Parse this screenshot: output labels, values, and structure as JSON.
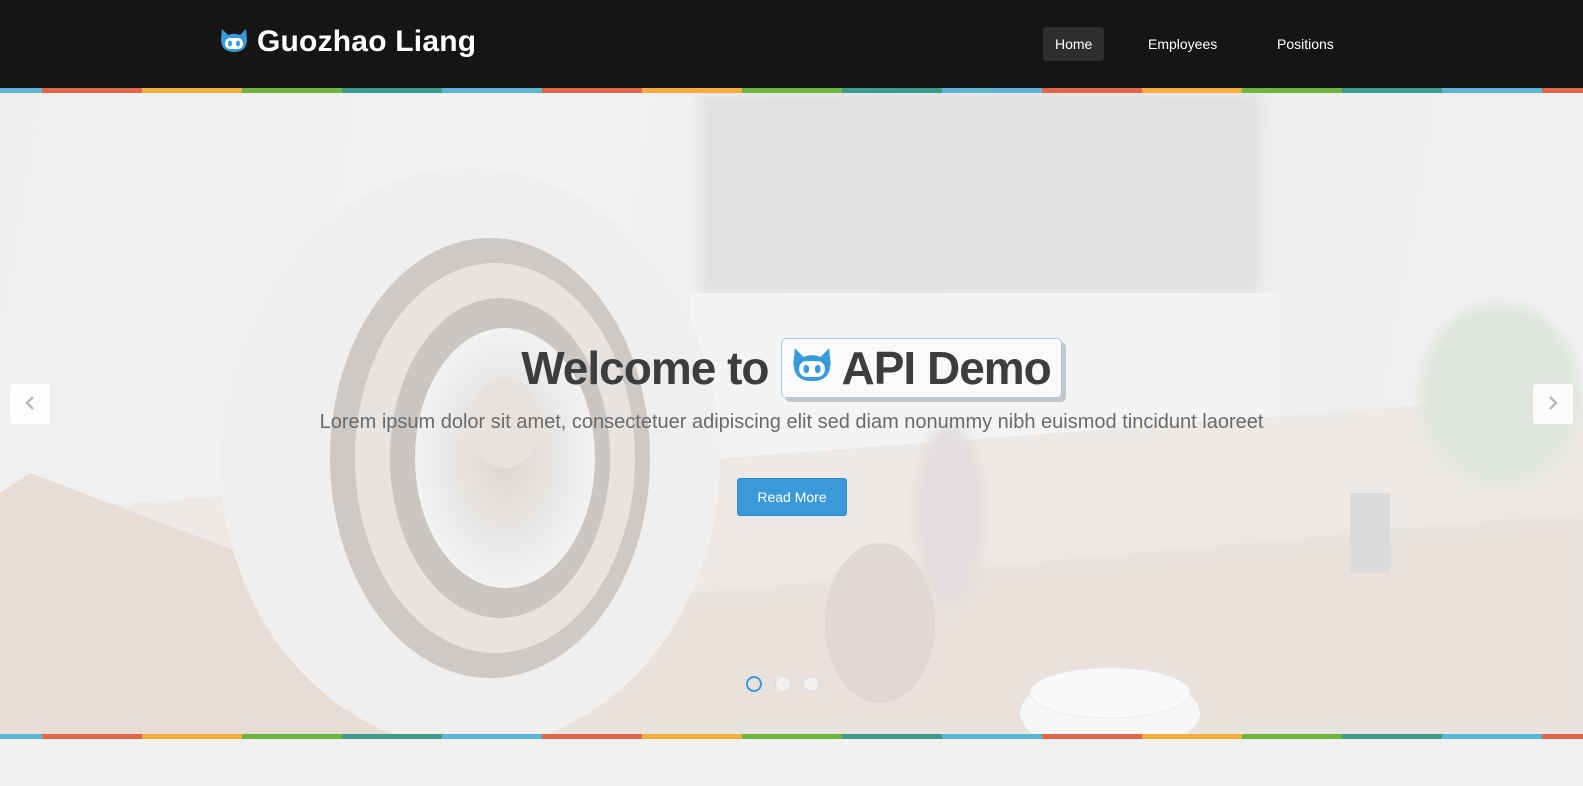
{
  "header": {
    "brand": "Guozhao Liang",
    "brand_icon": "github-octocat-icon",
    "nav": [
      {
        "label": "Home",
        "active": true
      },
      {
        "label": "Employees",
        "active": false
      },
      {
        "label": "Positions",
        "active": false
      }
    ]
  },
  "hero": {
    "title_prefix": "Welcome to",
    "title_badge": "API Demo",
    "badge_icon": "github-octocat-icon",
    "subtitle": "Lorem ipsum dolor sit amet, consectetuer adipiscing elit sed diam nonummy nibh euismod tincidunt laoreet",
    "button_label": "Read More",
    "prev_icon": "chevron-left-icon",
    "next_icon": "chevron-right-icon",
    "slide_count": 3,
    "active_slide": 1
  },
  "colors": {
    "navbar_bg": "#151515",
    "accent": "#3a9ad9",
    "stripe": [
      "#5bb5d5",
      "#e2674a",
      "#f2ad3c",
      "#6bb540",
      "#3e9a8a"
    ]
  }
}
